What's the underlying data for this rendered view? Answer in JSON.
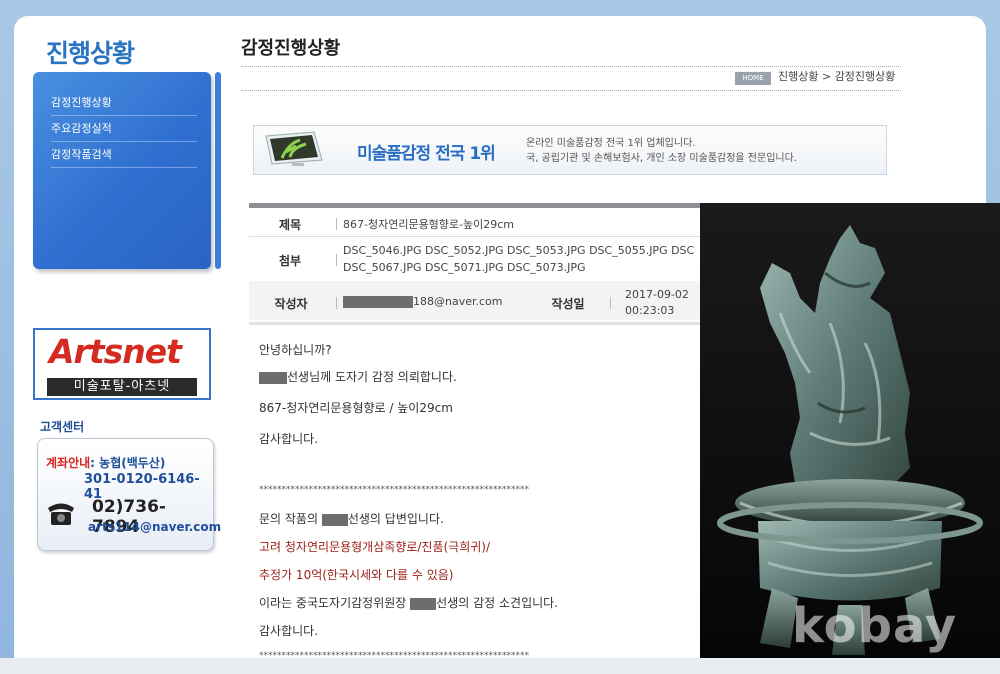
{
  "sidebar": {
    "title": "진행상황",
    "menu": [
      {
        "label": "감정진행상황"
      },
      {
        "label": "주요감정실적"
      },
      {
        "label": "감정작품검색"
      }
    ],
    "artsnet": {
      "logo": "Artsnet",
      "subtitle": "미술포탈-아츠넷"
    },
    "customer_center": {
      "title": "고객센터",
      "bank_label": "계좌안내",
      "bank_name": ": 농협(백두산)",
      "account": "301-0120-6146-41",
      "phone": "02)736-7894",
      "email": "arts114@naver.com"
    }
  },
  "header": {
    "title": "감정진행상황",
    "home_badge": "HOME",
    "breadcrumb": "진행상황 > 감정진행상황"
  },
  "banner": {
    "title": "미술품감정 전국 1위",
    "desc_line1": "온라인 미술품감정 전국 1위 업체입니다.",
    "desc_line2": "국, 공립기관 및 손해보험사, 개인 소장 미술품감정을 전문입니다."
  },
  "post": {
    "subject_label": "제목",
    "subject": "867-청자연리문용형향로-높이29cm",
    "attach_label": "첨부",
    "attach_line1": "DSC_5046.JPG  DSC_5052.JPG  DSC_5053.JPG  DSC_5055.JPG  DSC",
    "attach_line2": "DSC_5067.JPG  DSC_5071.JPG  DSC_5073.JPG",
    "author_label": "작성자",
    "author_email": "188@naver.com",
    "date_label": "작성일",
    "date": "2017-09-02",
    "time": "00:23:03"
  },
  "content": {
    "greeting": "안녕하십니까?",
    "request": "선생님께 도자기 감정 의뢰합니다.",
    "item": "867-청자연리문용형향로 / 높이29cm",
    "thanks1": "감사합니다.",
    "stars": "************************************************************",
    "reply_a": "문의 작품의 ",
    "reply_b": "선생의 답변입니다.",
    "verdict": "고려 청자연리문용형개삼족향로/진품(극희귀)/",
    "estimate": "추정가 10억(한국시세와 다를 수 있음)",
    "opinion_a": "이라는 중국도자기감정위원장 ",
    "opinion_b": "선생의 감정 소견입니다.",
    "thanks2": "감사합니다."
  },
  "photo": {
    "watermark": "kobay"
  }
}
